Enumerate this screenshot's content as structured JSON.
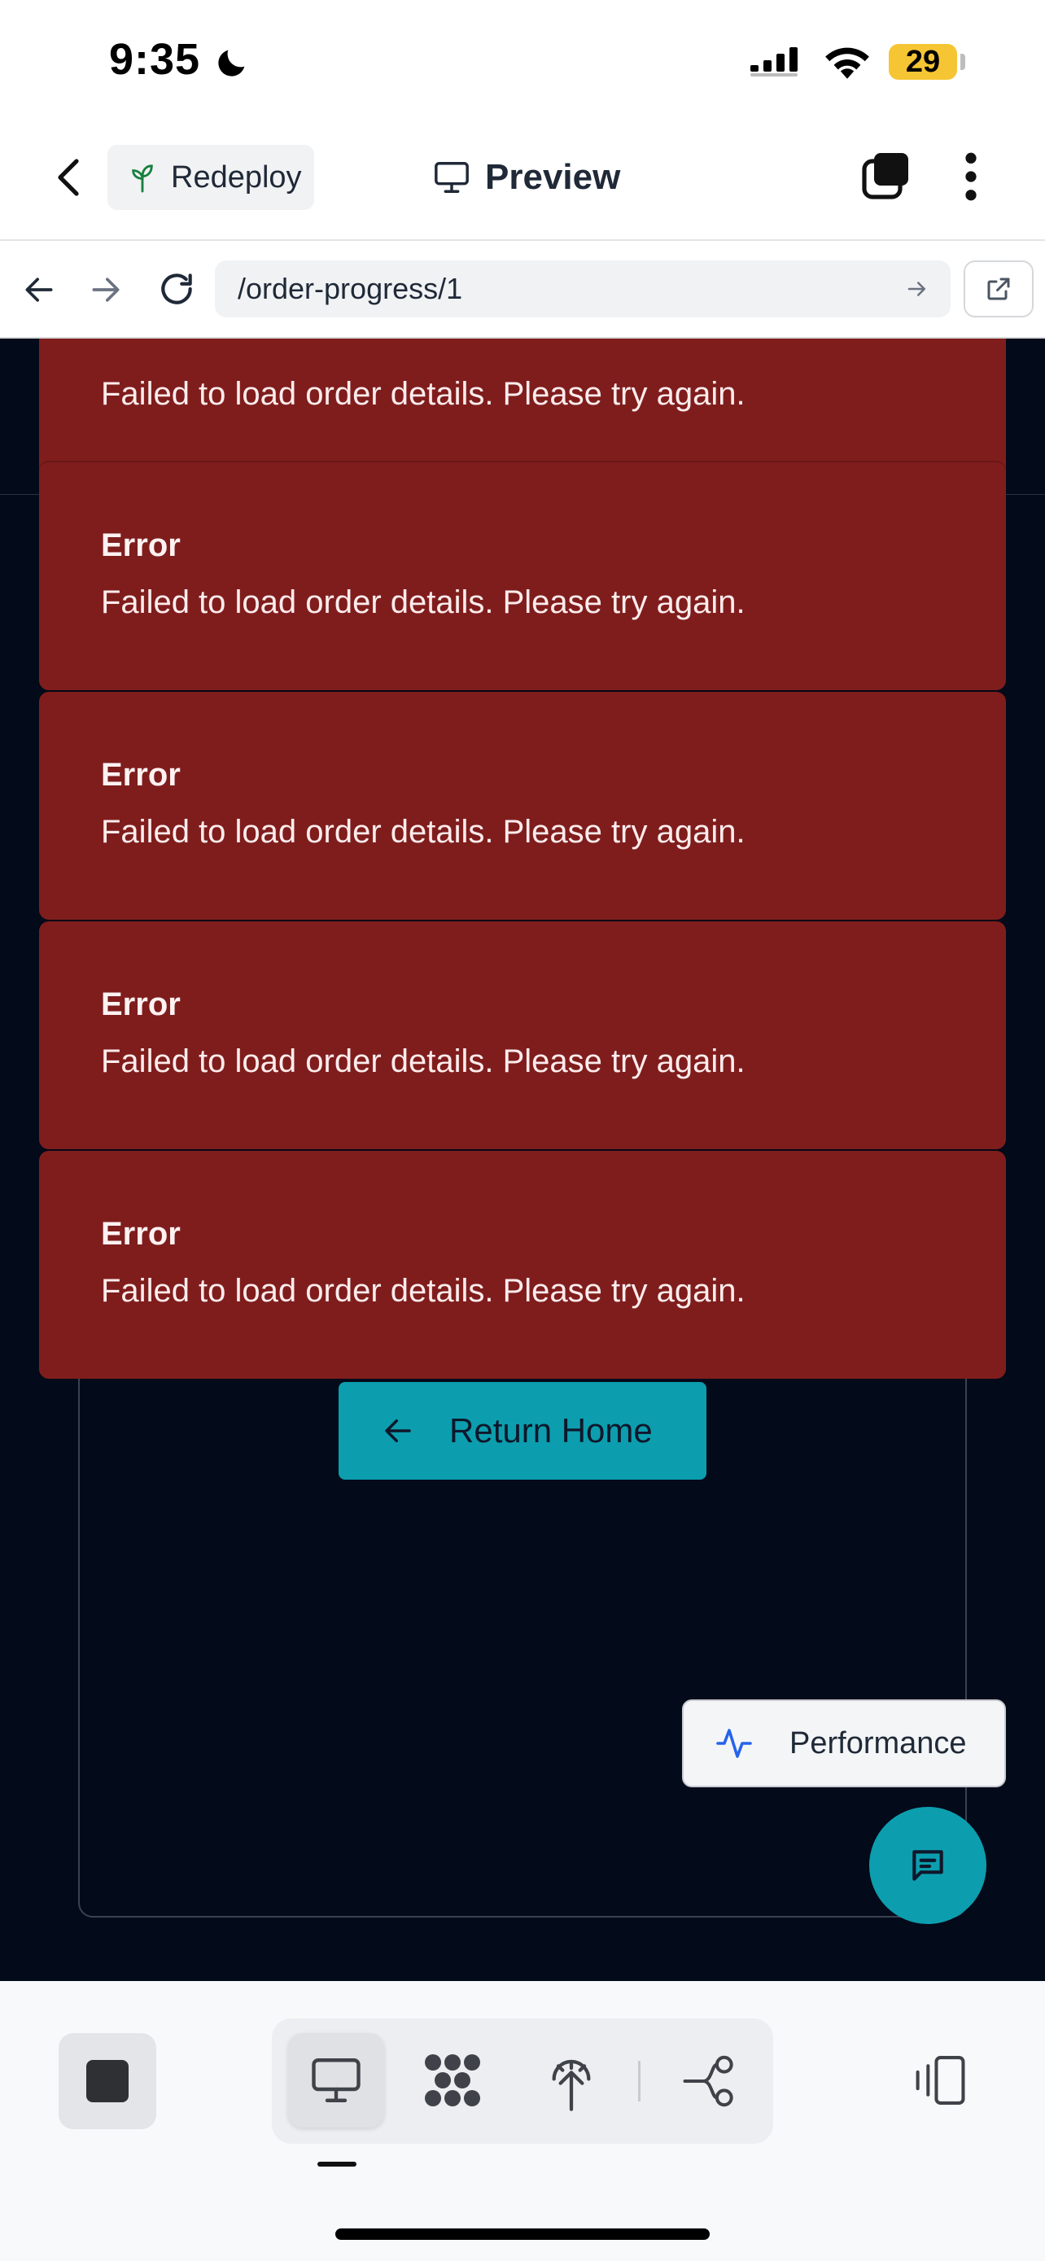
{
  "status_bar": {
    "time": "9:35",
    "battery": "29"
  },
  "header": {
    "redeploy_label": "Redeploy",
    "preview_label": "Preview"
  },
  "url_bar": {
    "value": "/order-progress/1"
  },
  "toasts": [
    {
      "title": "",
      "message": "Failed to load order details. Please try again."
    },
    {
      "title": "Error",
      "message": "Failed to load order details. Please try again."
    },
    {
      "title": "Error",
      "message": "Failed to load order details. Please try again."
    },
    {
      "title": "Error",
      "message": "Failed to load order details. Please try again."
    },
    {
      "title": "Error",
      "message": "Failed to load order details. Please try again."
    }
  ],
  "main": {
    "return_home_label": "Return Home"
  },
  "performance_label": "Performance",
  "colors": {
    "toast_bg": "#7f1d1d",
    "accent": "#0c9eae",
    "app_bg": "#030a1a"
  },
  "icons": {
    "status": [
      "moon-icon",
      "signal-icon",
      "wifi-icon",
      "battery-icon"
    ],
    "header": [
      "back-chevron-icon",
      "sprout-icon",
      "monitor-icon",
      "tabs-icon",
      "more-vertical-icon"
    ],
    "url": [
      "back-arrow-icon",
      "forward-arrow-icon",
      "reload-icon",
      "go-arrow-icon",
      "external-link-icon"
    ],
    "toolbar": [
      "stop-icon",
      "monitor-icon",
      "dots-grid-icon",
      "deploy-icon",
      "share-nodes-icon",
      "device-rotate-icon"
    ]
  }
}
